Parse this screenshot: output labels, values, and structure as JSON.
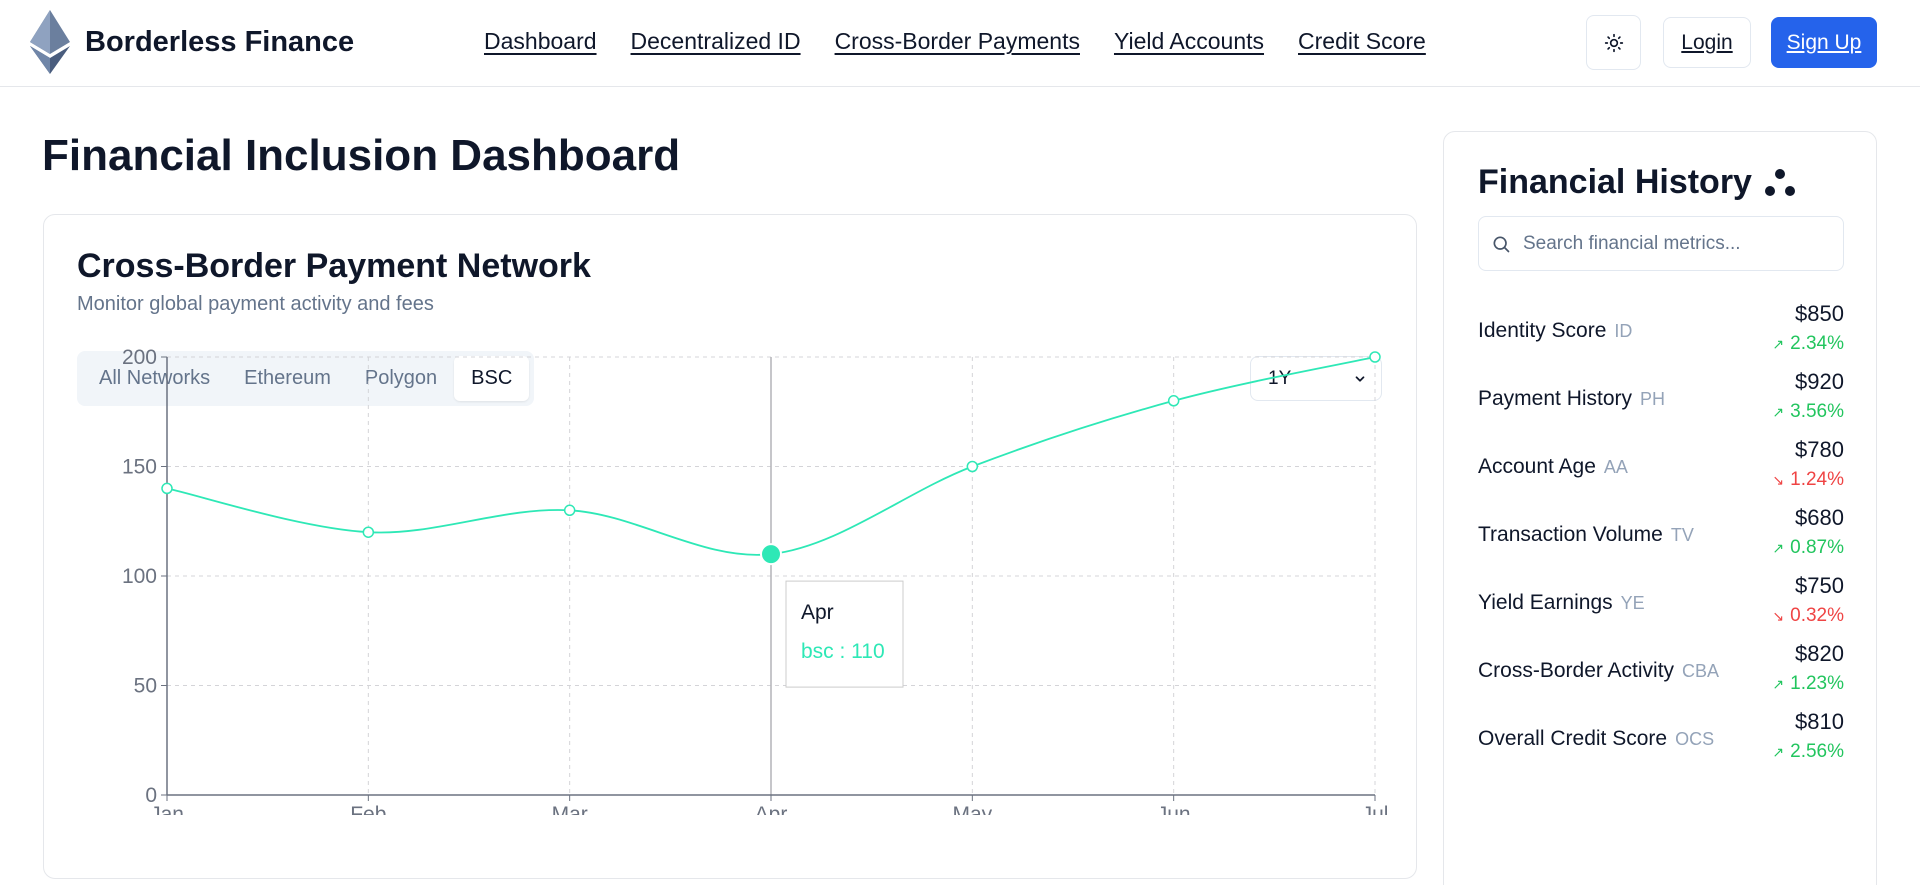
{
  "brand": {
    "name": "Borderless Finance",
    "logo_icon": "ethereum-diamond-icon"
  },
  "nav": {
    "items": [
      {
        "label": "Dashboard"
      },
      {
        "label": "Decentralized ID"
      },
      {
        "label": "Cross-Border Payments"
      },
      {
        "label": "Yield Accounts"
      },
      {
        "label": "Credit Score"
      }
    ]
  },
  "header_actions": {
    "theme_icon": "sun-icon",
    "login_label": "Login",
    "signup_label": "Sign Up",
    "signup_color": "#2563eb"
  },
  "page": {
    "title": "Financial Inclusion Dashboard"
  },
  "chart_card": {
    "title": "Cross-Border Payment Network",
    "subtitle": "Monitor global payment activity and fees",
    "tabs": [
      {
        "label": "All Networks",
        "active": false
      },
      {
        "label": "Ethereum",
        "active": false
      },
      {
        "label": "Polygon",
        "active": false
      },
      {
        "label": "BSC",
        "active": true
      }
    ],
    "range_select": {
      "value": "1Y"
    },
    "tooltip": {
      "title": "Apr",
      "text": "bsc : 110"
    }
  },
  "chart_data": {
    "type": "line",
    "categories": [
      "Jan",
      "Feb",
      "Mar",
      "Apr",
      "May",
      "Jun",
      "Jul"
    ],
    "series": [
      {
        "name": "bsc",
        "values": [
          140,
          120,
          130,
          110,
          150,
          180,
          200
        ],
        "color": "#2ee8b6"
      }
    ],
    "yticks": [
      0,
      50,
      100,
      150,
      200
    ],
    "ylim": [
      0,
      200
    ],
    "grid": true,
    "active_point": "Apr"
  },
  "side_panel": {
    "title": "Financial History",
    "title_icon": "dots-icon",
    "search": {
      "placeholder": "Search financial metrics...",
      "value": ""
    },
    "metrics": [
      {
        "name": "Identity Score",
        "abbr": "ID",
        "value": "$850",
        "change": "2.34%",
        "direction": "up"
      },
      {
        "name": "Payment History",
        "abbr": "PH",
        "value": "$920",
        "change": "3.56%",
        "direction": "up"
      },
      {
        "name": "Account Age",
        "abbr": "AA",
        "value": "$780",
        "change": "1.24%",
        "direction": "down"
      },
      {
        "name": "Transaction Volume",
        "abbr": "TV",
        "value": "$680",
        "change": "0.87%",
        "direction": "up"
      },
      {
        "name": "Yield Earnings",
        "abbr": "YE",
        "value": "$750",
        "change": "0.32%",
        "direction": "down"
      },
      {
        "name": "Cross-Border Activity",
        "abbr": "CBA",
        "value": "$820",
        "change": "1.23%",
        "direction": "up"
      },
      {
        "name": "Overall Credit Score",
        "abbr": "OCS",
        "value": "$810",
        "change": "2.56%",
        "direction": "up"
      }
    ]
  }
}
